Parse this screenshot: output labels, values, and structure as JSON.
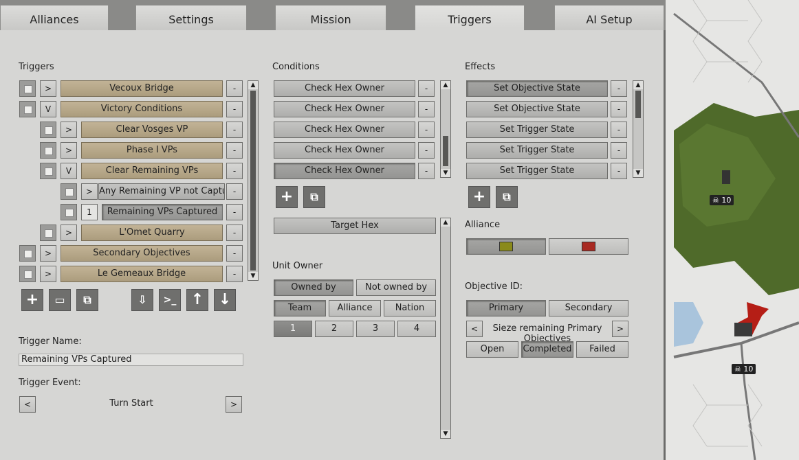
{
  "tabs": [
    "Alliances",
    "Settings",
    "Mission",
    "Triggers",
    "AI Setup"
  ],
  "triggers": {
    "heading": "Triggers",
    "items": [
      {
        "expander": ">",
        "label": "Vecoux Bridge"
      },
      {
        "expander": "V",
        "label": "Victory Conditions"
      },
      {
        "expander": ">",
        "label": "Clear Vosges VP"
      },
      {
        "expander": ">",
        "label": "Phase I VPs"
      },
      {
        "expander": "V",
        "label": "Clear Remaining VPs"
      },
      {
        "expander": ">",
        "label": "Any Remaining VP not Captured"
      },
      {
        "expander": "1",
        "label": "Remaining VPs Captured"
      },
      {
        "expander": ">",
        "label": "L'Omet Quarry"
      },
      {
        "expander": ">",
        "label": "Secondary Objectives"
      },
      {
        "expander": ">",
        "label": "Le Gemeaux Bridge"
      }
    ],
    "remove_label": "-",
    "toolbar_icons": [
      "add-icon",
      "folder-icon",
      "copy-icon",
      "import-icon",
      "console-icon",
      "arrow-up-icon",
      "arrow-down-icon"
    ],
    "name_label": "Trigger Name:",
    "name_value": "Remaining VPs Captured",
    "event_label": "Trigger Event:",
    "event_value": "Turn Start",
    "event_prev": "<",
    "event_next": ">"
  },
  "conditions": {
    "heading": "Conditions",
    "items": [
      "Check Hex Owner",
      "Check Hex Owner",
      "Check Hex Owner",
      "Check Hex Owner",
      "Check Hex Owner"
    ],
    "remove_label": "-",
    "target_hex": "Target Hex",
    "unit_owner_label": "Unit Owner",
    "owned_by": "Owned by",
    "not_owned_by": "Not owned by",
    "team": "Team",
    "alliance": "Alliance",
    "nation": "Nation",
    "numbers": [
      "1",
      "2",
      "3",
      "4"
    ]
  },
  "effects": {
    "heading": "Effects",
    "items": [
      "Set Objective State",
      "Set Objective State",
      "Set Trigger State",
      "Set Trigger State",
      "Set Trigger State"
    ],
    "remove_label": "-",
    "alliance_label": "Alliance",
    "alliance_colors": [
      "#8a8a1a",
      "#a82a22"
    ],
    "objective_label": "Objective ID:",
    "primary": "Primary",
    "secondary": "Secondary",
    "objective_value": "Sieze remaining Primary Objectives",
    "obj_prev": "<",
    "obj_next": ">",
    "open": "Open",
    "completed": "Completed",
    "failed": "Failed"
  },
  "map": {
    "counter_top": "10",
    "counter_bottom": "10"
  }
}
